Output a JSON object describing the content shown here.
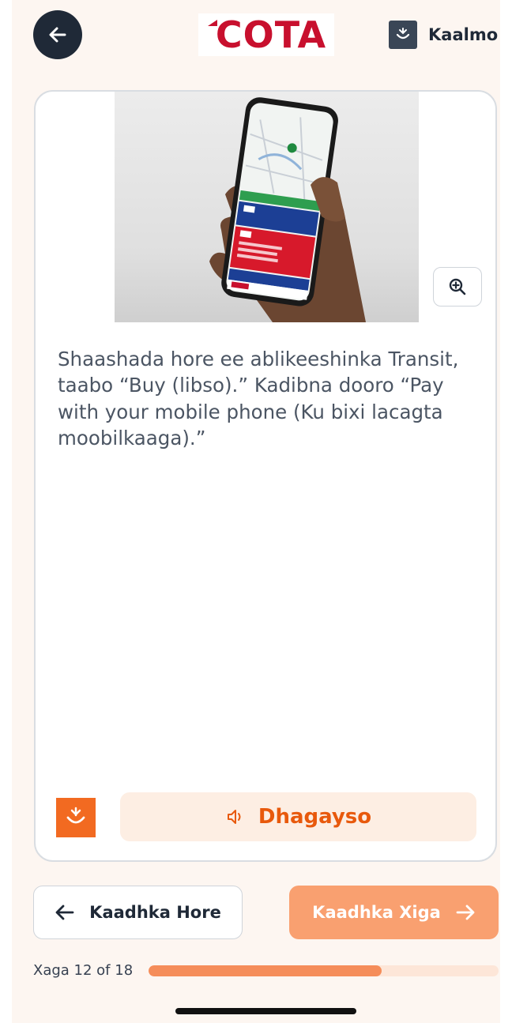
{
  "header": {
    "logo_text": "COTA",
    "help_label": "Kaalmo",
    "back_icon": "arrow-left-icon",
    "help_icon": "sign-language-icon"
  },
  "card": {
    "instruction": "Shaashada hore ee ablikeeshinka Transit, taabo “Buy (libso).” Kadibna dooro “Pay with your mobile phone (Ku bixi lacagta moobilkaaga).”",
    "zoom_icon": "zoom-in-icon",
    "listen_label": "Dhagayso",
    "listen_icon": "speaker-icon"
  },
  "navigation": {
    "prev_label": "Kaadhka Hore",
    "next_label": "Kaadhka Xiga"
  },
  "progress": {
    "label": "Xaga 12 of 18",
    "current": 12,
    "total": 18
  },
  "colors": {
    "brand_red": "#c8102e",
    "accent_orange": "#f26a21",
    "next_button": "#f9a070",
    "dark": "#1f2937"
  }
}
